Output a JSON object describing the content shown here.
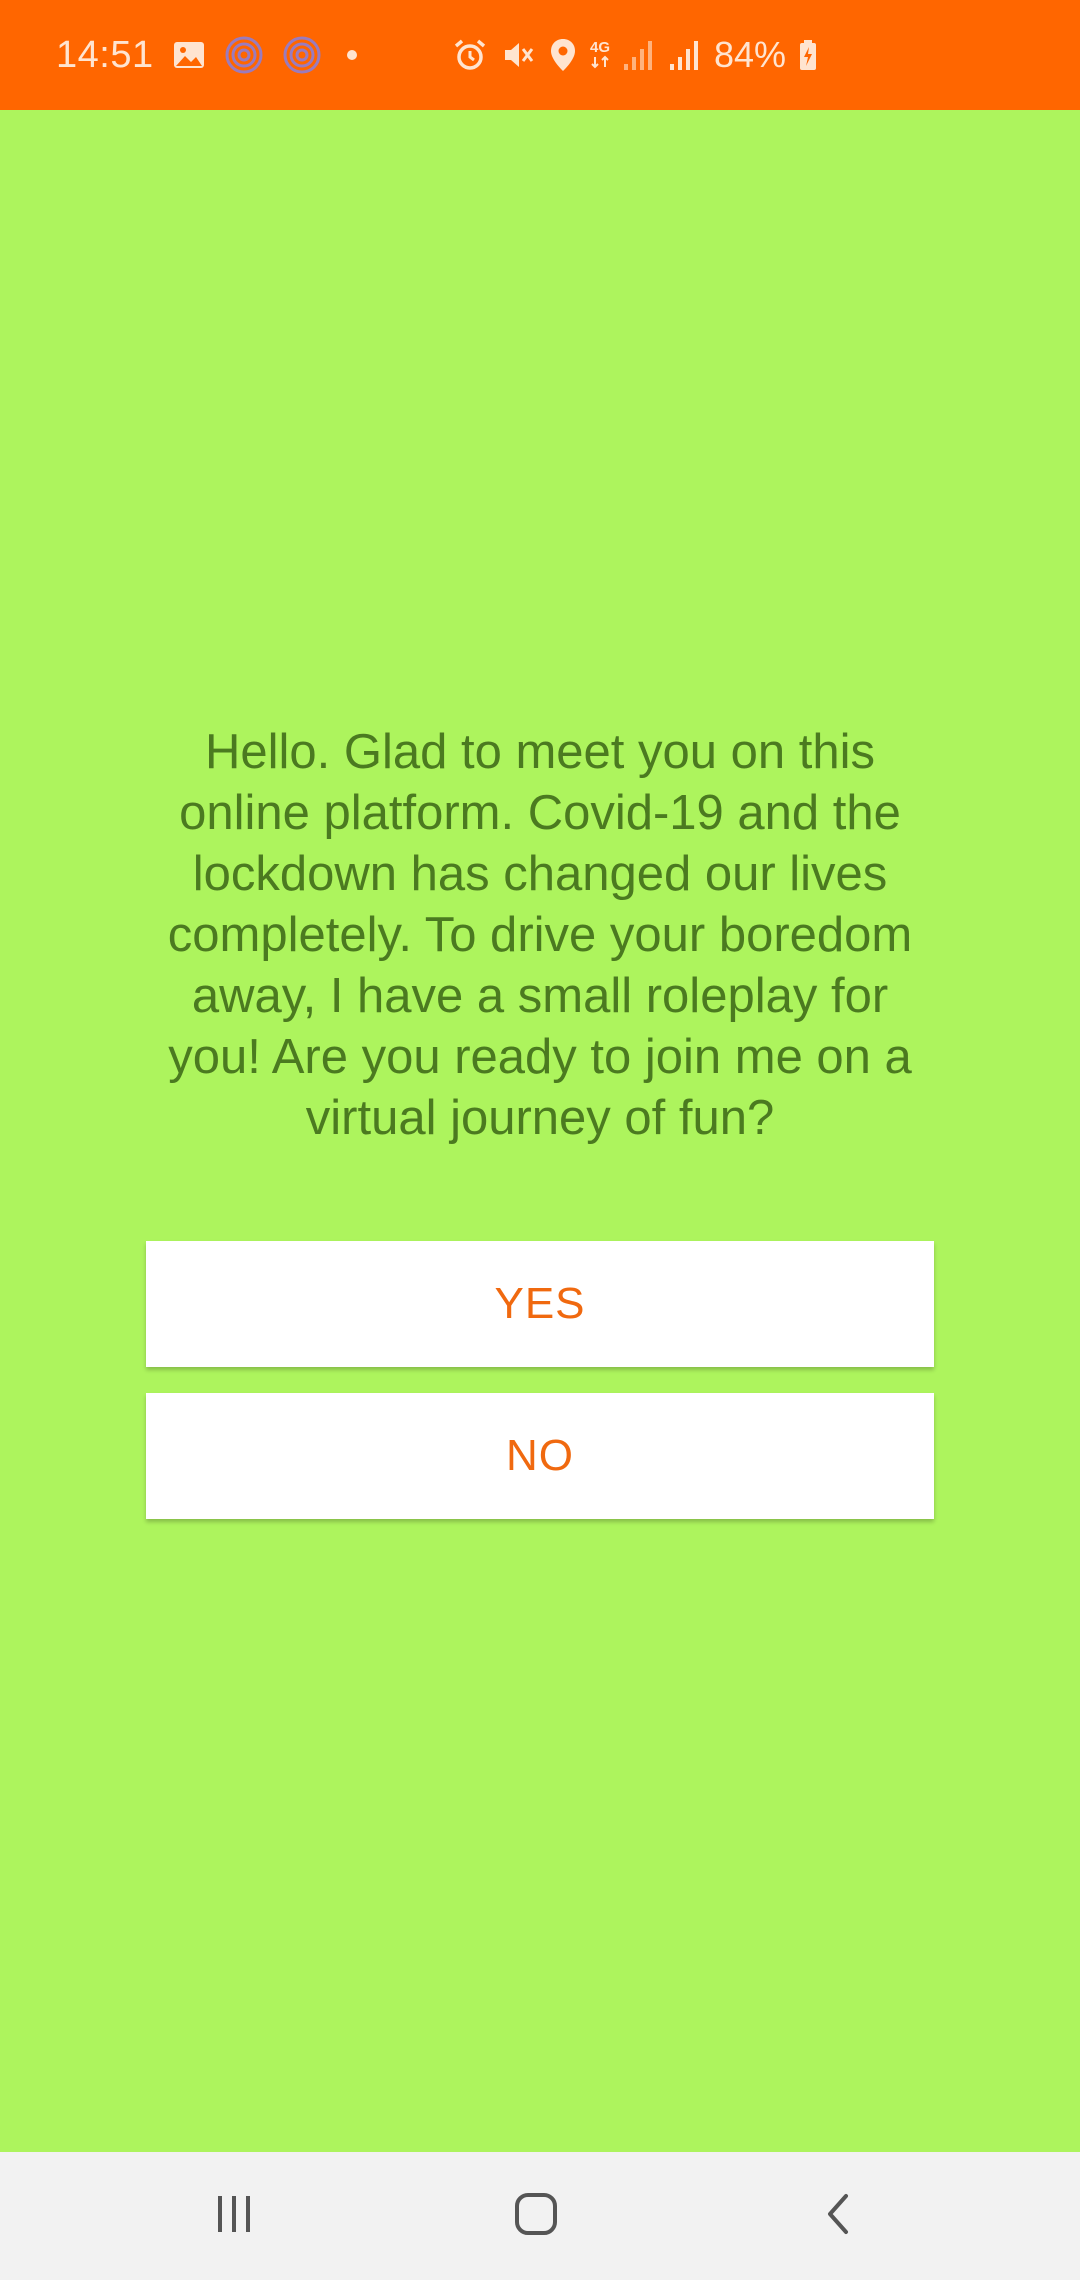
{
  "status_bar": {
    "time": "14:51",
    "network": "4G",
    "battery": "84%",
    "left_icons": [
      "image-icon",
      "target-icon",
      "target-icon",
      "dot-icon"
    ],
    "right_icons": [
      "alarm-icon",
      "mute-icon",
      "location-icon",
      "network-4g-icon",
      "signal-icon",
      "signal-icon",
      "battery-charging-icon"
    ]
  },
  "main": {
    "prompt": "Hello. Glad to meet you on this online platform. Covid-19 and the lockdown has changed our lives completely. To drive your boredom away, I have a small roleplay for you! Are you ready to join me on a virtual journey of fun?",
    "yes_label": "YES",
    "no_label": "NO"
  },
  "nav_bar": {
    "icons": [
      "recents-icon",
      "home-icon",
      "back-icon"
    ]
  },
  "colors": {
    "status_bar_bg": "#ff6600",
    "background": "#adf45d",
    "text": "#4b7a20",
    "button_text": "#f0690f",
    "button_bg": "#ffffff",
    "nav_bar_bg": "#f2f2f2"
  }
}
